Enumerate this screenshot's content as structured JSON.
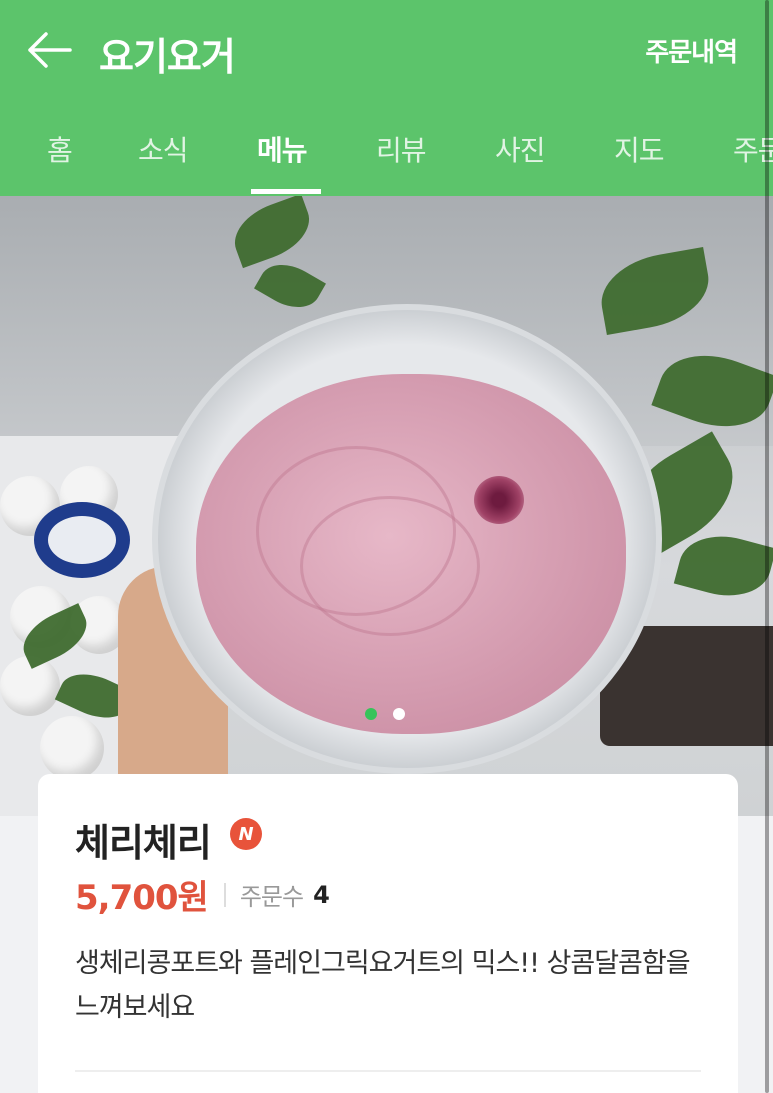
{
  "header": {
    "title": "요기요거",
    "orders_link": "주문내역"
  },
  "tabs": [
    {
      "label": "홈"
    },
    {
      "label": "소식"
    },
    {
      "label": "메뉴",
      "active": true
    },
    {
      "label": "리뷰"
    },
    {
      "label": "사진"
    },
    {
      "label": "지도"
    },
    {
      "label": "주문"
    }
  ],
  "carousel": {
    "current_index": 1,
    "total": 2
  },
  "product": {
    "name": "체리체리",
    "badge": "N",
    "price": "5,700원",
    "order_label": "주문수",
    "order_count": "4",
    "description": "생체리콩포트와 플레인그릭요거트의 믹스!! 상콤달콤함을 느껴보세요"
  },
  "colors": {
    "brand_green": "#5cc46b",
    "price_red": "#e0533d",
    "badge_red": "#e8533a"
  }
}
